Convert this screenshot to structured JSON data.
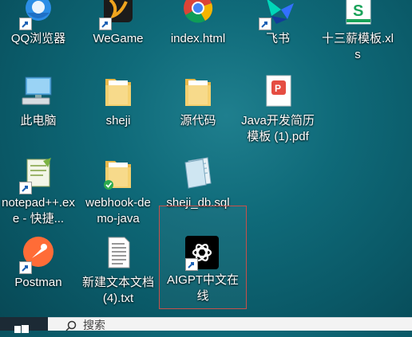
{
  "desktop": {
    "icons": [
      {
        "label": "QQ浏览器"
      },
      {
        "label": "WeGame"
      },
      {
        "label": "index.html"
      },
      {
        "label": "飞书"
      },
      {
        "label": "十三薪模板.xls"
      },
      {
        "label": "此电脑"
      },
      {
        "label": "sheji"
      },
      {
        "label": "源代码"
      },
      {
        "label": "Java开发简历模板 (1).pdf"
      },
      {
        "label": "notepad++.exe - 快捷..."
      },
      {
        "label": "webhook-demo-java"
      },
      {
        "label": "sheji_db.sql"
      },
      {
        "label": "Postman"
      },
      {
        "label": "新建文本文档 (4).txt"
      },
      {
        "label": "AIGPT中文在线"
      }
    ]
  },
  "taskbar": {
    "search_placeholder": "搜索"
  }
}
